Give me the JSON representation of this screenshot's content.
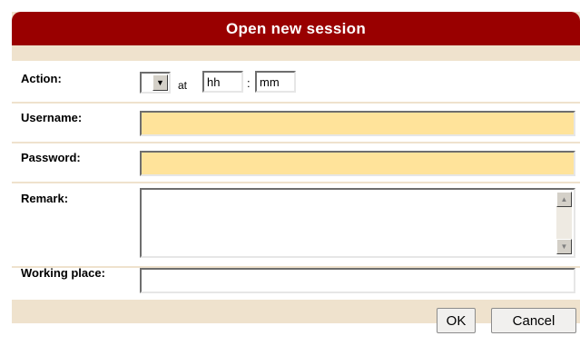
{
  "dialog": {
    "title": "Open new session",
    "colors": {
      "title_bg": "#990000",
      "panel_bg": "#efe2cd",
      "required_field_bg": "#ffe39a"
    }
  },
  "form": {
    "action": {
      "label": "Action:",
      "selected": "",
      "at_text": "at",
      "hour_value": "hh",
      "sep": ":",
      "minute_value": "mm"
    },
    "username": {
      "label": "Username:",
      "value": ""
    },
    "password": {
      "label": "Password:",
      "value": ""
    },
    "remark": {
      "label": "Remark:",
      "value": "",
      "scroll_up_icon": "triangle-up",
      "scroll_down_icon": "triangle-down"
    },
    "working_place": {
      "label": "Working place:",
      "value": ""
    }
  },
  "buttons": {
    "ok": "OK",
    "cancel": "Cancel"
  }
}
